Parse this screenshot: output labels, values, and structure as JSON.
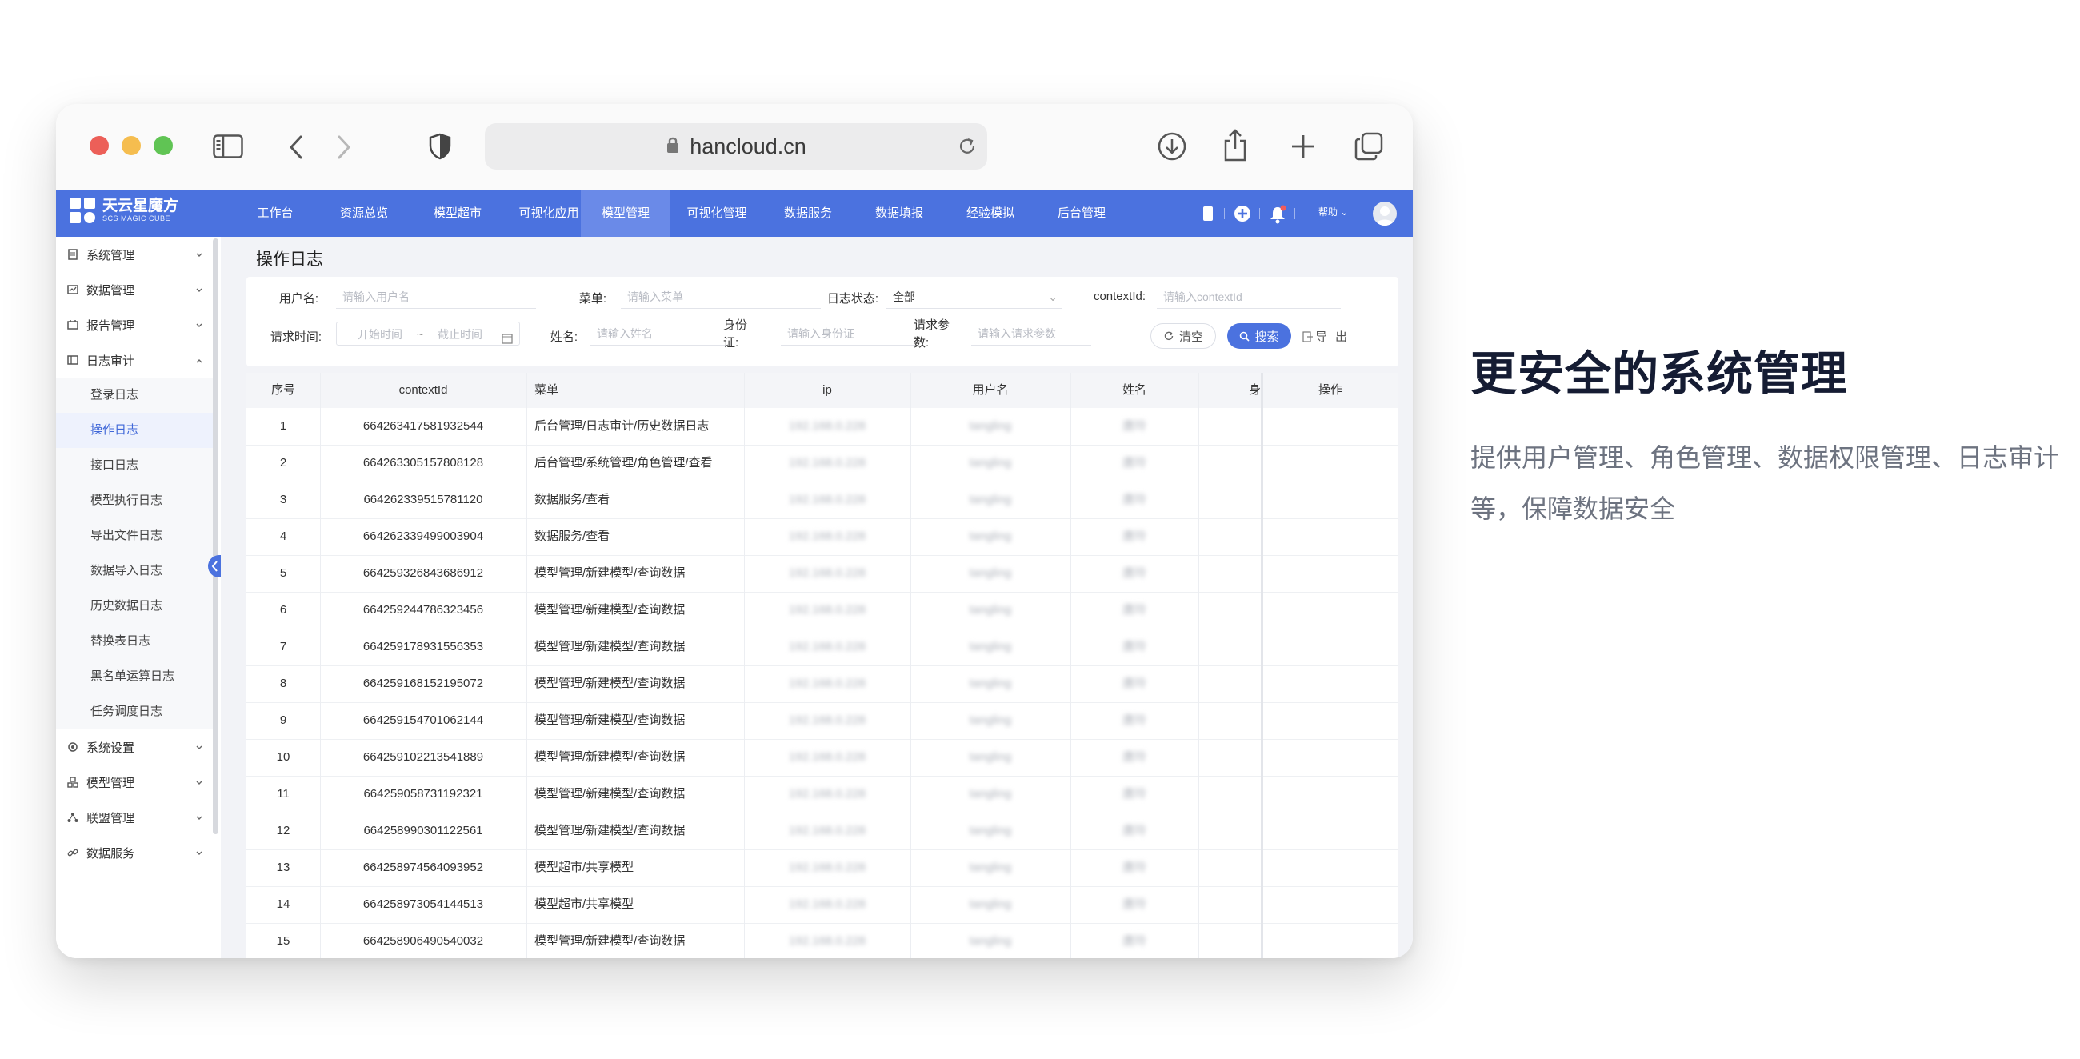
{
  "browser": {
    "url": "hancloud.cn",
    "colors": {
      "close": "#ec5f58",
      "minimize": "#f5bd4f",
      "zoom": "#60c454"
    },
    "icons": [
      "sidebar-icon",
      "back-icon",
      "forward-icon",
      "shield-icon",
      "lock-icon",
      "reload-icon",
      "download-icon",
      "share-icon",
      "new-tab-icon",
      "tabs-icon"
    ]
  },
  "app": {
    "logo_title": "天云星魔方",
    "logo_sub": "SCS MAGIC CUBE",
    "nav": [
      "工作台",
      "资源总览",
      "模型超市",
      "可视化应用",
      "模型管理",
      "可视化管理",
      "数据服务",
      "数据填报",
      "经验模拟",
      "后台管理"
    ],
    "nav_active": "模型管理",
    "help": "帮助",
    "accent": "#4b72df"
  },
  "sidebar": {
    "groups_top": [
      "系统管理",
      "数据管理",
      "报告管理",
      "日志审计"
    ],
    "log_items": [
      "登录日志",
      "操作日志",
      "接口日志",
      "模型执行日志",
      "导出文件日志",
      "数据导入日志",
      "历史数据日志",
      "替换表日志",
      "黑名单运算日志",
      "任务调度日志"
    ],
    "active": "操作日志",
    "groups_bottom": [
      "系统设置",
      "模型管理",
      "联盟管理",
      "数据服务"
    ]
  },
  "page": {
    "title": "操作日志",
    "filter": {
      "username_label": "用户名:",
      "username_ph": "请输入用户名",
      "menu_label": "菜单:",
      "menu_ph": "请输入菜单",
      "status_label": "日志状态:",
      "status_value": "全部",
      "context_label": "contextId:",
      "context_ph": "请输入contextId",
      "time_label": "请求时间:",
      "time_start_ph": "开始时间",
      "time_sep": "~",
      "time_end_ph": "截止时间",
      "name_label": "姓名:",
      "name_ph": "请输入姓名",
      "id_label": "身份证:",
      "id_ph": "请输入身份证",
      "param_label": "请求参数:",
      "param_ph": "请输入请求参数",
      "clear": "清空",
      "search": "搜索",
      "export": "导出"
    },
    "table": {
      "headers": [
        "序号",
        "contextId",
        "菜单",
        "ip",
        "用户名",
        "姓名",
        "身",
        "操作"
      ],
      "rows": [
        {
          "no": "1",
          "cid": "664263417581932544",
          "menu": "后台管理/日志审计/历史数据日志",
          "ip": "192.168.0.228",
          "user": "tangling",
          "name": "唐玲"
        },
        {
          "no": "2",
          "cid": "664263305157808128",
          "menu": "后台管理/系统管理/角色管理/查看",
          "ip": "192.168.0.228",
          "user": "tangling",
          "name": "唐玲"
        },
        {
          "no": "3",
          "cid": "664262339515781120",
          "menu": "数据服务/查看",
          "ip": "192.168.0.228",
          "user": "tangling",
          "name": "唐玲"
        },
        {
          "no": "4",
          "cid": "664262339499003904",
          "menu": "数据服务/查看",
          "ip": "192.168.0.228",
          "user": "tangling",
          "name": "唐玲"
        },
        {
          "no": "5",
          "cid": "664259326843686912",
          "menu": "模型管理/新建模型/查询数据",
          "ip": "192.168.0.228",
          "user": "tangling",
          "name": "唐玲"
        },
        {
          "no": "6",
          "cid": "664259244786323456",
          "menu": "模型管理/新建模型/查询数据",
          "ip": "192.168.0.228",
          "user": "tangling",
          "name": "唐玲"
        },
        {
          "no": "7",
          "cid": "664259178931556353",
          "menu": "模型管理/新建模型/查询数据",
          "ip": "192.168.0.228",
          "user": "tangling",
          "name": "唐玲"
        },
        {
          "no": "8",
          "cid": "664259168152195072",
          "menu": "模型管理/新建模型/查询数据",
          "ip": "192.168.0.228",
          "user": "tangling",
          "name": "唐玲"
        },
        {
          "no": "9",
          "cid": "664259154701062144",
          "menu": "模型管理/新建模型/查询数据",
          "ip": "192.168.0.228",
          "user": "tangling",
          "name": "唐玲"
        },
        {
          "no": "10",
          "cid": "664259102213541889",
          "menu": "模型管理/新建模型/查询数据",
          "ip": "192.168.0.228",
          "user": "tangling",
          "name": "唐玲"
        },
        {
          "no": "11",
          "cid": "664259058731192321",
          "menu": "模型管理/新建模型/查询数据",
          "ip": "192.168.0.228",
          "user": "tangling",
          "name": "唐玲"
        },
        {
          "no": "12",
          "cid": "664258990301122561",
          "menu": "模型管理/新建模型/查询数据",
          "ip": "192.168.0.228",
          "user": "tangling",
          "name": "唐玲"
        },
        {
          "no": "13",
          "cid": "664258974564093952",
          "menu": "模型超市/共享模型",
          "ip": "192.168.0.228",
          "user": "tangling",
          "name": "唐玲"
        },
        {
          "no": "14",
          "cid": "664258973054144513",
          "menu": "模型超市/共享模型",
          "ip": "192.168.0.228",
          "user": "tangling",
          "name": "唐玲"
        },
        {
          "no": "15",
          "cid": "664258906490540032",
          "menu": "模型管理/新建模型/查询数据",
          "ip": "192.168.0.228",
          "user": "tangling",
          "name": "唐玲"
        }
      ]
    }
  },
  "promo": {
    "headline": "更安全的系统管理",
    "description": "提供用户管理、角色管理、数据权限管理、日志审计等，保障数据安全"
  }
}
